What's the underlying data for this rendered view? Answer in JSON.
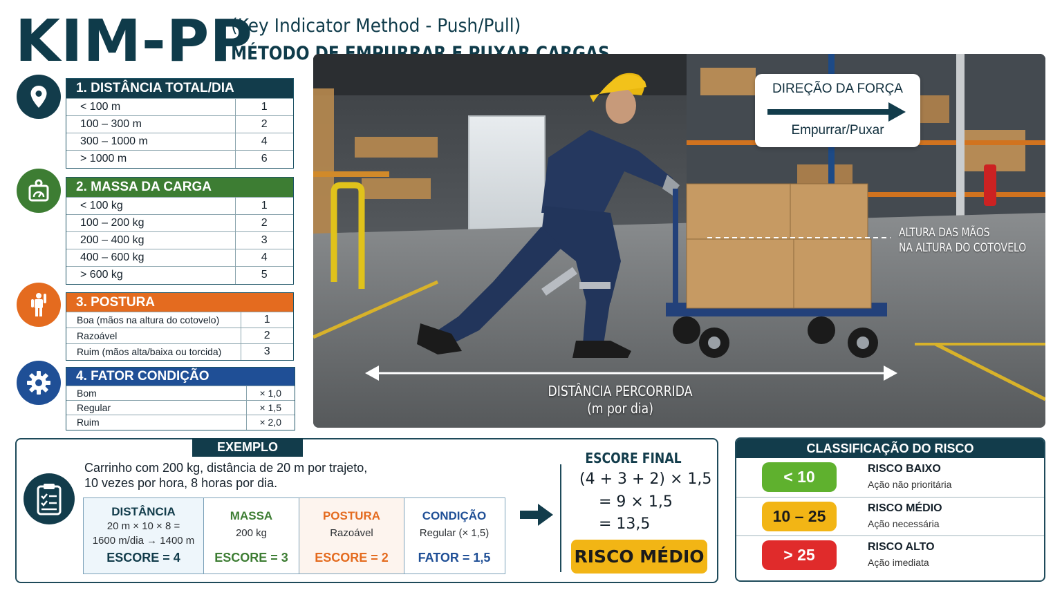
{
  "header": {
    "title": "KIM-PP",
    "subtitle": "(Key Indicator Method - Push/Pull)",
    "subtitle2": "MÉTODO DE EMPURRAR E PUXAR CARGAS"
  },
  "colors": {
    "navy": "#123c4b",
    "green": "#3d7d33",
    "orange": "#e46b1f",
    "blue": "#1f4f96",
    "yellow": "#f2b515",
    "red": "#e02b2b",
    "lightgreen": "#5fb12e"
  },
  "factors": [
    {
      "title": "1. DISTÂNCIA TOTAL/DIA",
      "icon": "location-pin-icon",
      "rows": [
        {
          "label": "< 100 m",
          "score": "1"
        },
        {
          "label": "100 – 300 m",
          "score": "2"
        },
        {
          "label": "300 – 1000 m",
          "score": "4"
        },
        {
          "label": "> 1000 m",
          "score": "6"
        }
      ]
    },
    {
      "title": "2. MASSA DA CARGA",
      "icon": "scale-weight-icon",
      "rows": [
        {
          "label": "< 100 kg",
          "score": "1"
        },
        {
          "label": "100 – 200 kg",
          "score": "2"
        },
        {
          "label": "200 – 400 kg",
          "score": "3"
        },
        {
          "label": "400 – 600 kg",
          "score": "4"
        },
        {
          "label": "> 600 kg",
          "score": "5"
        }
      ]
    },
    {
      "title": "3. POSTURA",
      "icon": "person-posture-icon",
      "rows": [
        {
          "label": "Boa (mãos na altura do cotovelo)",
          "score": "1"
        },
        {
          "label": "Razoável",
          "score": "2"
        },
        {
          "label": "Ruim (mãos alta/baixa ou torcida)",
          "score": "3"
        }
      ]
    },
    {
      "title": "4. FATOR CONDIÇÃO",
      "icon": "gear-icon",
      "rows": [
        {
          "label": "Bom",
          "score": "× 1,0"
        },
        {
          "label": "Regular",
          "score": "× 1,5"
        },
        {
          "label": "Ruim",
          "score": "× 2,0"
        }
      ]
    }
  ],
  "photo": {
    "force_title": "DIREÇÃO DA FORÇA",
    "force_sub": "Empurrar/Puxar",
    "hand_label_1": "ALTURA DAS MÃOS",
    "hand_label_2": "NA ALTURA DO COTOVELO",
    "distance_label_1": "DISTÂNCIA PERCORRIDA",
    "distance_label_2": "(m por dia)"
  },
  "example": {
    "tab": "EXEMPLO",
    "desc_1": "Carrinho com 200 kg, distância de 20 m por trajeto,",
    "desc_2": "10 vezes por hora, 8 horas por dia.",
    "columns": [
      {
        "head": "DISTÂNCIA",
        "v1": "20 m × 10 × 8 =",
        "v2": "1600 m/dia → 1400 m",
        "score": "ESCORE = 4"
      },
      {
        "head": "MASSA",
        "v1": "200 kg",
        "v2": "",
        "score": "ESCORE = 3"
      },
      {
        "head": "POSTURA",
        "v1": "Razoável",
        "v2": "",
        "score": "ESCORE = 2"
      },
      {
        "head": "CONDIÇÃO",
        "v1": "Regular (× 1,5)",
        "v2": "",
        "score": "FATOR = 1,5"
      }
    ],
    "final_title": "ESCORE FINAL",
    "calc_1": "(4 + 3 + 2) × 1,5",
    "calc_2": "= 9 × 1,5",
    "calc_3": "= 13,5",
    "result": "RISCO MÉDIO"
  },
  "risk": {
    "title": "CLASSIFICAÇÃO DO RISCO",
    "rows": [
      {
        "range": "< 10",
        "name": "RISCO BAIXO",
        "action": "Ação não prioritária",
        "color": "#5fb12e",
        "text_color": "#ffffff"
      },
      {
        "range": "10 – 25",
        "name": "RISCO MÉDIO",
        "action": "Ação necessária",
        "color": "#f2b515",
        "text_color": "#1b1b1b"
      },
      {
        "range": "> 25",
        "name": "RISCO ALTO",
        "action": "Ação imediata",
        "color": "#e02b2b",
        "text_color": "#ffffff"
      }
    ]
  }
}
